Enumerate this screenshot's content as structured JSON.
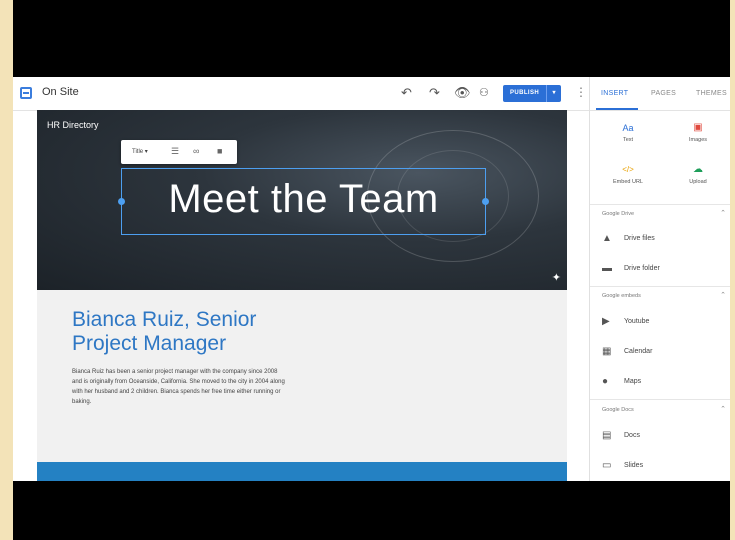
{
  "topbar": {
    "site_title": "On Site",
    "undo_icon": "undo-icon",
    "redo_icon": "redo-icon",
    "preview_icon": "eye-icon",
    "share_icon": "add-person-icon",
    "publish_label": "PUBLISH",
    "more_icon": "more-vert-icon"
  },
  "panel": {
    "tabs": [
      "INSERT",
      "PAGES",
      "THEMES"
    ],
    "insert_items": [
      {
        "label": "Text",
        "icon": "Aa"
      },
      {
        "label": "Images",
        "icon": "image-icon"
      },
      {
        "label": "Embed URL",
        "icon": "code-icon"
      },
      {
        "label": "Upload",
        "icon": "cloud-upload-icon"
      }
    ],
    "sections": [
      {
        "title": "Google Drive",
        "items": [
          "Drive files",
          "Drive folder"
        ]
      },
      {
        "title": "Google embeds",
        "items": [
          "Youtube",
          "Calendar",
          "Maps"
        ]
      },
      {
        "title": "Google Docs",
        "items": [
          "Docs",
          "Slides"
        ]
      }
    ]
  },
  "hero": {
    "header_label": "HR Directory",
    "toolbar_style": "Title",
    "title": "Meet the Team"
  },
  "content": {
    "name": "Bianca Ruiz, Senior Project Manager",
    "bio": "Bianca Ruiz has been a senior project manager with the company since 2008 and is originally from Oceanside, California.  She moved to the city in 2004 along with her husband and 2 children.  Bianca spends her free time either running or baking."
  },
  "colors": {
    "accent": "#2b6fd6",
    "heading_blue": "#2e77c4",
    "band_blue": "#2481c3",
    "frame_bg": "#f3e3b8"
  }
}
